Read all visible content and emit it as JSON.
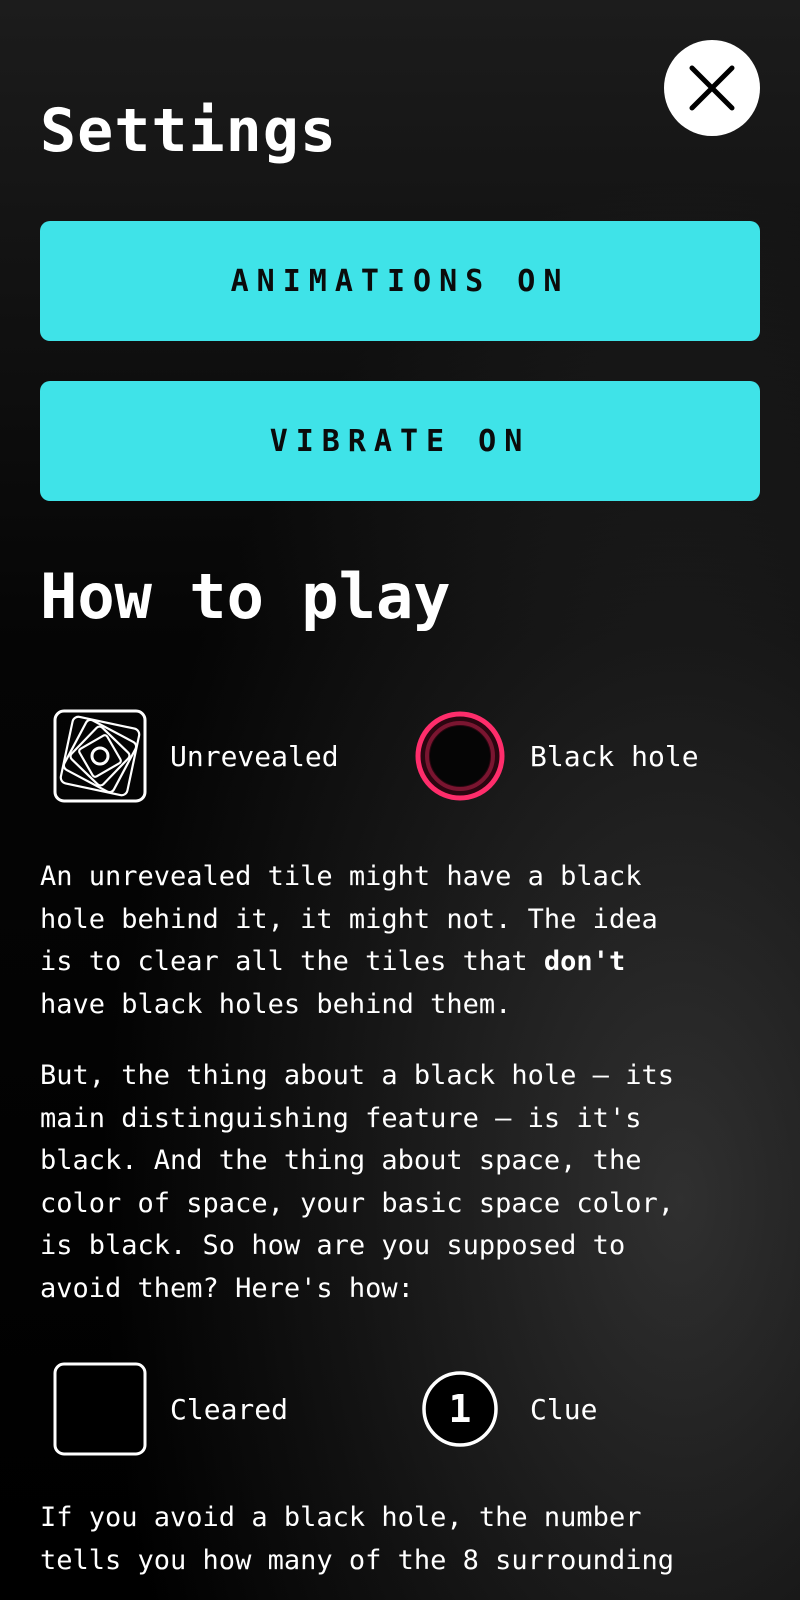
{
  "settings": {
    "title": "Settings",
    "close_icon": "close-icon",
    "animations_label": "ANIMATIONS ON",
    "vibrate_label": "VIBRATE ON",
    "accent_color": "#3fe3e8"
  },
  "how_to_play": {
    "heading": "How to play",
    "legend1": [
      {
        "label": "Unrevealed",
        "icon": "unrevealed-tile-icon"
      },
      {
        "label": "Black hole",
        "icon": "black-hole-icon",
        "color": "#ff2d6b"
      }
    ],
    "para1_a": "An unrevealed tile might have a black\nhole behind it, it might not. The idea\nis to clear all the tiles that ",
    "para1_bold": "don't",
    "para1_b": "\nhave black holes behind them.",
    "para2": "But, the thing about a black hole – its\nmain distinguishing feature – is it's\nblack. And the thing about space, the\ncolor of space, your basic space color,\nis black. So how are you supposed to\navoid them? Here's how:",
    "legend2": [
      {
        "label": "Cleared",
        "icon": "cleared-tile-icon"
      },
      {
        "label": "Clue",
        "icon": "clue-icon",
        "number": "1"
      }
    ],
    "para3": "If you avoid a black hole, the number\ntells you how many of the 8 surrounding"
  }
}
